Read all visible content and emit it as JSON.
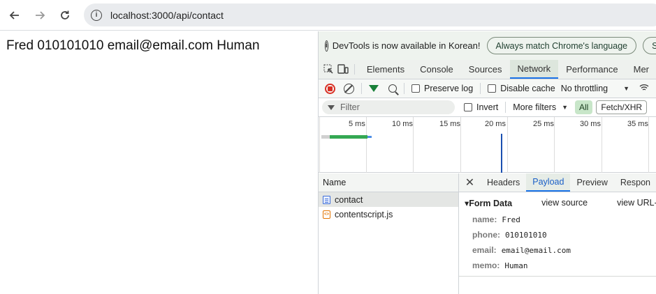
{
  "browser": {
    "url": "localhost:3000/api/contact",
    "back_icon": "arrow-left",
    "forward_icon": "arrow-right",
    "reload_icon": "reload",
    "site_info_icon": "info"
  },
  "page": {
    "content_text": "Fred 010101010 email@email.com Human"
  },
  "devtools": {
    "infobar": {
      "message": "DevTools is now available in Korean!",
      "match_language_button": "Always match Chrome's language",
      "switch_button": "Sw"
    },
    "tabs": [
      "Elements",
      "Console",
      "Sources",
      "Network",
      "Performance",
      "Mer"
    ],
    "active_tab": "Network",
    "network_toolbar": {
      "preserve_log": "Preserve log",
      "disable_cache": "Disable cache",
      "throttling": "No throttling"
    },
    "filter_bar": {
      "filter_placeholder": "Filter",
      "invert": "Invert",
      "more_filters": "More filters",
      "all_chip": "All",
      "fetch_xhr_chip": "Fetch/XHR"
    },
    "timeline": {
      "ticks": [
        "5 ms",
        "10 ms",
        "15 ms",
        "20 ms",
        "25 ms",
        "30 ms",
        "35 ms"
      ]
    },
    "request_list": {
      "header": "Name",
      "items": [
        {
          "name": "contact",
          "type": "document",
          "selected": true
        },
        {
          "name": "contentscript.js",
          "type": "script",
          "selected": false
        }
      ]
    },
    "detail": {
      "tabs": [
        "Headers",
        "Payload",
        "Preview",
        "Respon"
      ],
      "active_tab": "Payload",
      "form_data_title": "Form Data",
      "view_source": "view source",
      "view_url": "view URL-e",
      "fields": [
        {
          "key": "name:",
          "value": "Fred"
        },
        {
          "key": "phone:",
          "value": "010101010"
        },
        {
          "key": "email:",
          "value": "email@email.com"
        },
        {
          "key": "memo:",
          "value": "Human"
        }
      ]
    }
  },
  "colors": {
    "accent": "#1a73e8",
    "record_red": "#d93025",
    "filter_green": "#188038",
    "infobar_bg": "#eef3ee"
  }
}
